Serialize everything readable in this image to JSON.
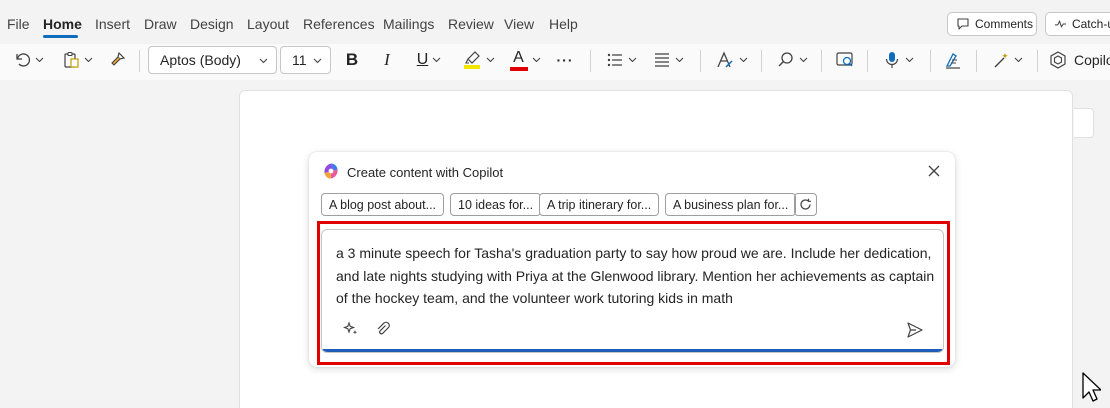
{
  "menu": {
    "tabs": [
      "File",
      "Home",
      "Insert",
      "Draw",
      "Design",
      "Layout",
      "References",
      "Mailings",
      "Review",
      "View",
      "Help"
    ],
    "active": "Home",
    "comments_label": "Comments",
    "catchup_label": "Catch-u"
  },
  "ribbon": {
    "font_name": "Aptos (Body)",
    "font_size": "11",
    "bold": "B",
    "italic": "I",
    "underline": "U",
    "font_color_glyph": "A",
    "more": "···",
    "copilot_label": "Copilo",
    "highlight_color": "#f2e600",
    "font_color": "#e00000"
  },
  "copilot": {
    "title": "Create content with Copilot",
    "chips": [
      "A blog post about...",
      "10 ideas for...",
      "A trip itinerary for...",
      "A business plan for..."
    ],
    "prompt": "a 3 minute speech for Tasha's graduation party to say how proud we are. Include her dedication, and late nights studying with Priya at the Glenwood library. Mention her achievements as captain of the hockey team, and the volunteer work tutoring kids in math",
    "accent": "#1e5db8",
    "highlight_border": "#e00000"
  }
}
